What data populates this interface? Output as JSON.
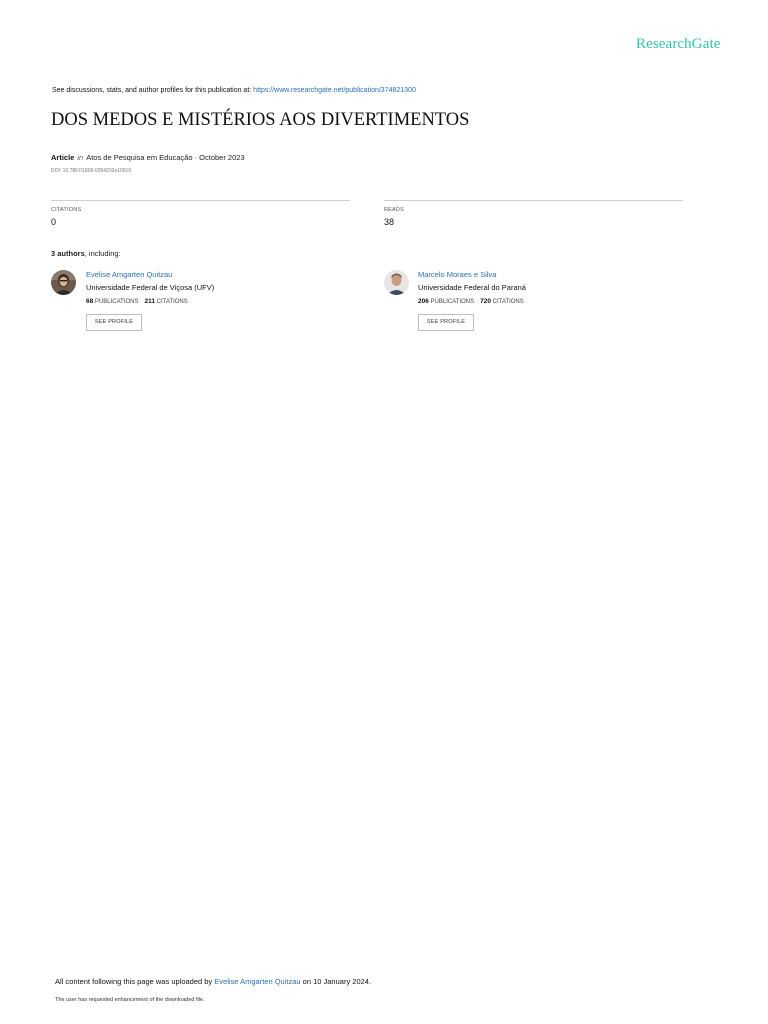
{
  "brand": {
    "logo_text": "ResearchGate",
    "accent": "#2fc4b2",
    "link_color": "#2a6fb0"
  },
  "header": {
    "discussion_prefix": "See discussions, stats, and author profiles for this publication at: ",
    "publication_url": "https://www.researchgate.net/publication/374821300"
  },
  "publication": {
    "title": "DOS MEDOS E MISTÉRIOS AOS DIVERTIMENTOS",
    "type": "Article",
    "in_word": "in",
    "journal_date": "Atos de Pesquisa em Educação · October 2023",
    "doi": "DOI: 10.7867/1809-0354202e10919"
  },
  "stats": {
    "citations_label": "CITATIONS",
    "citations_value": "0",
    "reads_label": "READS",
    "reads_value": "38"
  },
  "authors_heading": {
    "count": "3 authors",
    "suffix": ", including:"
  },
  "authors": [
    {
      "name": "Evelise Amgarten Quitzau",
      "institution": "Universidade Federal de Viçosa (UFV)",
      "publications": "68",
      "publications_label": "PUBLICATIONS",
      "citations": "211",
      "citations_label": "CITATIONS",
      "button": "SEE PROFILE"
    },
    {
      "name": "Marcelo Moraes e Silva",
      "institution": "Universidade Federal do Paraná",
      "publications": "206",
      "publications_label": "PUBLICATIONS",
      "citations": "720",
      "citations_label": "CITATIONS",
      "button": "SEE PROFILE"
    }
  ],
  "footer": {
    "upload_prefix": "All content following this page was uploaded by ",
    "uploader": "Evelise Amgarten Quitzau",
    "upload_suffix": " on 10 January 2024.",
    "enhancement_note": "The user has requested enhancement of the downloaded file."
  }
}
